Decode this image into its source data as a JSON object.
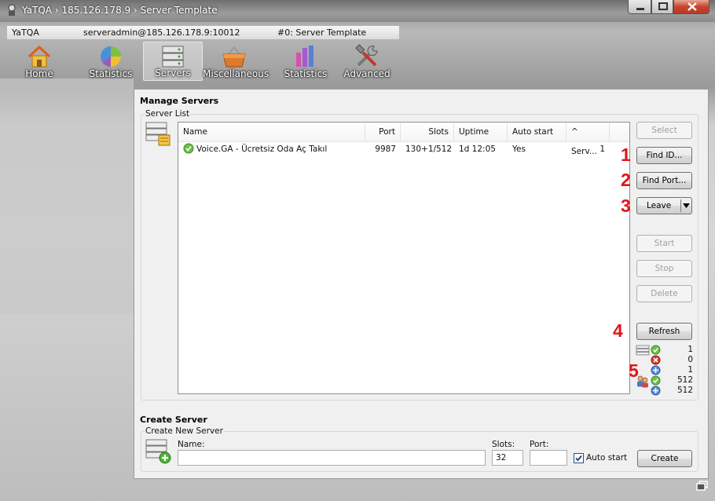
{
  "window": {
    "title": "YaTQA › 185.126.178.9 › Server Template"
  },
  "breadcrumb": [
    {
      "label": "YaTQA"
    },
    {
      "label": "serveradmin@185.126.178.9:10012"
    },
    {
      "label": "#0: Server Template"
    }
  ],
  "toolbar": [
    {
      "label": "Home",
      "icon": "home-icon"
    },
    {
      "label": "Statistics",
      "icon": "pie-chart-icon"
    },
    {
      "label": "Servers",
      "icon": "server-rack-icon",
      "active": true
    },
    {
      "label": "Miscellaneous",
      "icon": "basket-icon"
    },
    {
      "label": "Statistics",
      "icon": "bar-chart-icon"
    },
    {
      "label": "Advanced",
      "icon": "tools-icon"
    }
  ],
  "manage": {
    "title": "Manage Servers",
    "group_label": "Server List",
    "columns": [
      "Name",
      "Port",
      "Slots",
      "Uptime",
      "Auto start",
      "^ Serv..."
    ],
    "rows": [
      {
        "status": "online",
        "name": "Voice.GA - Ücretsiz Oda Aç Takıl",
        "port": "9987",
        "slots": "130+1/512",
        "uptime": "1d 12:05",
        "autostart": "Yes",
        "serv": "1"
      }
    ],
    "buttons": {
      "select": "Select",
      "find_id": "Find ID...",
      "find_port": "Find Port...",
      "leave": "Leave",
      "start": "Start",
      "stop": "Stop",
      "delete": "Delete",
      "refresh": "Refresh"
    },
    "annotations": [
      "1",
      "2",
      "3",
      "4",
      "5"
    ],
    "stats": {
      "online": "1",
      "offline": "0",
      "total_servers": "1",
      "users_online": "512",
      "users_total": "512"
    }
  },
  "create": {
    "title": "Create Server",
    "group_label": "Create New Server",
    "name_label": "Name:",
    "name_value": "",
    "slots_label": "Slots:",
    "slots_value": "32",
    "port_label": "Port:",
    "port_value": "",
    "autostart_label": "Auto start",
    "autostart_checked": true,
    "create_button": "Create"
  },
  "colors": {
    "annotation_red": "#e0151b",
    "status_green": "#4caf2a",
    "status_red": "#d83a2c",
    "status_blue": "#4a78c8"
  }
}
